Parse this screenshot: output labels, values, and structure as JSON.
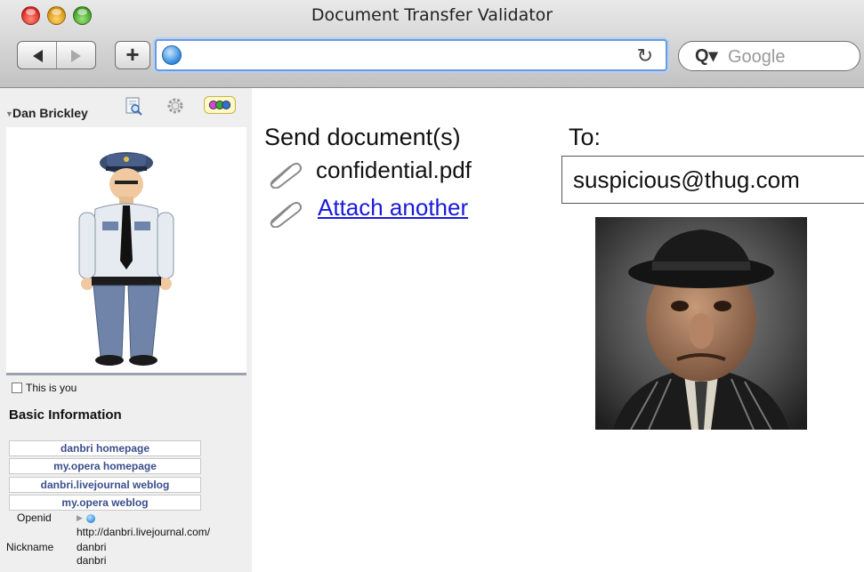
{
  "window": {
    "title": "Document Transfer Validator"
  },
  "toolbar": {
    "url_value": "",
    "search_placeholder": "Google",
    "add_label": "+"
  },
  "sidebar": {
    "name": "Dan Brickley",
    "this_is_you": "This is you",
    "basic_heading": "Basic Information",
    "links": [
      "danbri homepage",
      "my.opera homepage",
      "danbri.livejournal weblog",
      "my.opera weblog"
    ],
    "openid_label": "Openid",
    "openid_value": "http://danbri.livejournal.com/",
    "nickname_label": "Nickname",
    "nicknames": [
      "danbri",
      "danbri"
    ]
  },
  "main": {
    "send_heading": "Send document(s)",
    "attachment": "confidential.pdf",
    "attach_link": "Attach another",
    "to_label": "To:",
    "to_value": "suspicious@thug.com"
  },
  "colors": {
    "link": "#1a1adb",
    "sidebar_bg": "#efefef",
    "focus_ring": "#6a9ae0"
  },
  "icons": [
    "back-arrow-icon",
    "forward-arrow-icon",
    "globe-icon",
    "reload-icon",
    "search-icon",
    "document-icon",
    "gear-icon",
    "glasses-icon",
    "paperclip-icon",
    "openid-icon"
  ]
}
